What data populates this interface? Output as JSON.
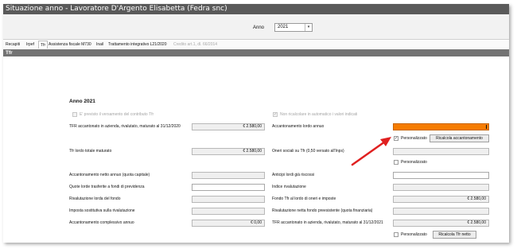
{
  "window": {
    "title": "Situazione anno - Lavoratore D'Argento Elisabetta (Fedra snc)"
  },
  "year_selector": {
    "label": "Anno",
    "value": "2021"
  },
  "tabs": [
    {
      "label": "Recapiti"
    },
    {
      "label": "Irpef"
    },
    {
      "label": "Tfr"
    },
    {
      "label": "Assistenza fiscale M730"
    },
    {
      "label": "Inail"
    },
    {
      "label": "Trattamento integrativo L21/2020"
    },
    {
      "label": "Credito art.1, dl. 66/2014"
    }
  ],
  "section": {
    "title": "Tfr"
  },
  "main": {
    "year_title": "Anno 2021",
    "left_check": {
      "label": "E' previsto il versamento del contributo Tfr",
      "checked": false
    },
    "right_check": {
      "label": "Non ricalcolare in automatico i valori indicati",
      "checked": true
    },
    "left_fields": [
      {
        "label": "TFR accantonato in azienda, rivalutato, maturato al 31/12/2020",
        "value": "€ 2.580,00"
      },
      {
        "label": "Tfr lordo totale maturato",
        "value": "€ 2.580,00"
      },
      {
        "label": "Accantonamento netto annuo (quota capitale)",
        "value": ""
      },
      {
        "label": "Quote lorde trasferite a fondi di previdenza",
        "value": ""
      },
      {
        "label": "Rivalutazione lorda del fondo",
        "value": ""
      },
      {
        "label": "Imposta sostitutiva sulla rivalutazione",
        "value": ""
      },
      {
        "label": "Accantonamento complessivo annuo",
        "value": "€ 0,00"
      }
    ],
    "right_fields": {
      "accantonamento_lordo": {
        "label": "Accantonamento lordo annuo",
        "value": ""
      },
      "personalizzato_1": {
        "label": "Personalizzato",
        "checked": true
      },
      "ricalcola_button": "Ricalcola accantonamento",
      "oneri_sociali": {
        "label": "Oneri sociali su Tfr (0,50 versato all'Inps)",
        "value": ""
      },
      "personalizzato_2": {
        "label": "Personalizzato",
        "checked": false
      },
      "anticipi": {
        "label": "Anticipi lordi già riscossi",
        "value": ""
      },
      "indice_rivalutazione": {
        "label": "Indice rivalutazione",
        "value": ""
      },
      "fondo_tfr": {
        "label": "Fondo Tfr al lordo di oneri e imposte",
        "value": "€ 2.580,00"
      },
      "rivalutazione_netta": {
        "label": "Rivalutazione netta fondo preesistente (quota finanziaria)",
        "value": ""
      },
      "tfr_accantonato_2021": {
        "label": "TFR accantonato in azienda, rivalutato, maturato al 31/12/2021",
        "value": "€ 2.580,00"
      },
      "personalizzato_3": {
        "label": "Personalizzato",
        "checked": false
      },
      "ricalcola_tfr_button": "Ricalcola Tfr netto"
    }
  },
  "colors": {
    "highlight_field": "#f57c00",
    "annotation_arrow": "#e02020",
    "title_bar": "#5a5a5a"
  }
}
